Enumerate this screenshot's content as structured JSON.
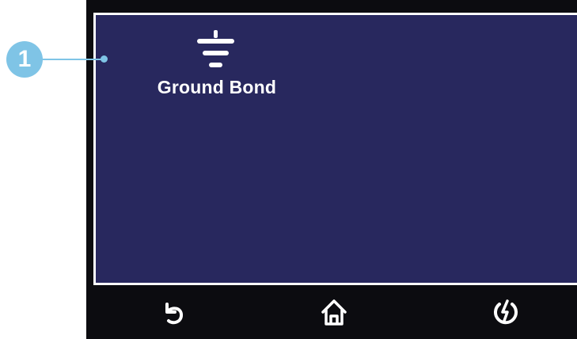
{
  "callout": {
    "number": "1"
  },
  "screen": {
    "tile": {
      "label": "Ground Bond",
      "icon": "ground-icon"
    }
  },
  "navbar": {
    "items": [
      {
        "name": "back",
        "icon": "back-arrow-icon"
      },
      {
        "name": "home",
        "icon": "home-icon"
      },
      {
        "name": "power",
        "icon": "power-icon"
      }
    ]
  },
  "colors": {
    "screen_bg": "#28285e",
    "bezel": "#0c0c10",
    "callout": "#7fc4e6",
    "text": "#ffffff"
  }
}
